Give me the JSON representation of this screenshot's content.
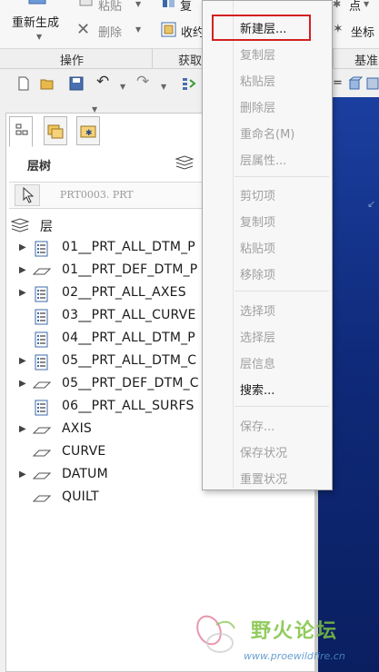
{
  "ribbon": {
    "regenerate_label": "重新生成",
    "paste_label": "粘贴",
    "delete_label": "删除",
    "copy_label_partial": "复",
    "collapse_label_partial": "收约",
    "point_label": "点",
    "csys_label_partial": "坐标",
    "groups": {
      "operations": "操作",
      "get_data_partial": "获取",
      "datum_partial": "基准"
    }
  },
  "panel": {
    "title": "层树",
    "model_name": "PRT0003. PRT",
    "root_label": "层"
  },
  "tree": [
    {
      "name": "01__PRT_ALL_DTM_P",
      "expandable": true,
      "icon": "layer-list-icon"
    },
    {
      "name": "01__PRT_DEF_DTM_P",
      "expandable": true,
      "icon": "layer-plane-icon"
    },
    {
      "name": "02__PRT_ALL_AXES",
      "expandable": true,
      "icon": "layer-list-icon"
    },
    {
      "name": "03__PRT_ALL_CURVE",
      "expandable": false,
      "icon": "layer-list-icon"
    },
    {
      "name": "04__PRT_ALL_DTM_P",
      "expandable": false,
      "icon": "layer-list-icon"
    },
    {
      "name": "05__PRT_ALL_DTM_C",
      "expandable": true,
      "icon": "layer-list-icon"
    },
    {
      "name": "05__PRT_DEF_DTM_C",
      "expandable": true,
      "icon": "layer-plane-icon"
    },
    {
      "name": "06__PRT_ALL_SURFS",
      "expandable": false,
      "icon": "layer-list-icon"
    },
    {
      "name": "AXIS",
      "expandable": true,
      "icon": "layer-plane-icon"
    },
    {
      "name": "CURVE",
      "expandable": false,
      "icon": "layer-plane-icon"
    },
    {
      "name": "DATUM",
      "expandable": true,
      "icon": "layer-plane-icon"
    },
    {
      "name": "QUILT",
      "expandable": false,
      "icon": "layer-plane-icon"
    }
  ],
  "menu": {
    "new_layer": "新建层...",
    "copy_layer": "复制层",
    "paste_layer": "粘贴层",
    "delete_layer": "删除层",
    "rename": "重命名(M)",
    "layer_props": "层属性...",
    "cut_item": "剪切项",
    "copy_item": "复制项",
    "paste_item": "粘贴项",
    "remove_item": "移除项",
    "select_item": "选择项",
    "select_layer": "选择层",
    "layer_info": "层信息",
    "search": "搜索...",
    "save": "保存...",
    "save_status": "保存状况",
    "reset_status": "重置状况"
  },
  "watermark": {
    "name": "野火论坛",
    "url": "www.proewildfire.cn"
  },
  "colors": {
    "highlight": "#d42020",
    "viewport": "#1b3fa0",
    "watermark_green": "#7fc241"
  }
}
